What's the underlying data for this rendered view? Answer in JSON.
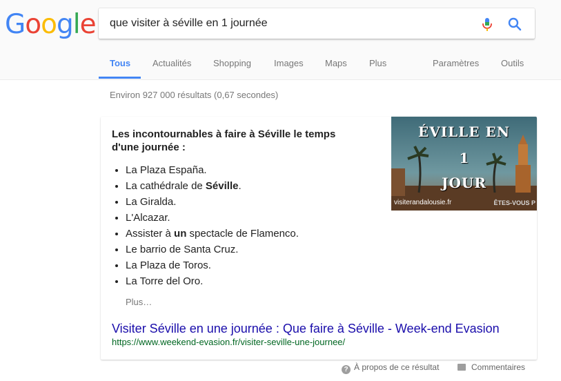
{
  "logo": {
    "letters": [
      {
        "ch": "G",
        "color": "#4285F4"
      },
      {
        "ch": "o",
        "color": "#EA4335"
      },
      {
        "ch": "o",
        "color": "#FBBC05"
      },
      {
        "ch": "g",
        "color": "#4285F4"
      },
      {
        "ch": "l",
        "color": "#34A853"
      },
      {
        "ch": "e",
        "color": "#EA4335"
      }
    ]
  },
  "search": {
    "query": "que visiter à séville en 1 journée",
    "mic_icon": "microphone-icon",
    "search_icon": "search-icon"
  },
  "tabs": {
    "all": "Tous",
    "news": "Actualités",
    "shopping": "Shopping",
    "images": "Images",
    "maps": "Maps",
    "more": "Plus",
    "settings": "Paramètres",
    "tools": "Outils"
  },
  "stats": "Environ 927 000 résultats (0,67 secondes)",
  "snippet": {
    "title": "Les incontournables à faire à Séville le temps d'une journée :",
    "items": [
      {
        "pre": "La Plaza España.",
        "bold": "",
        "post": ""
      },
      {
        "pre": "La cathédrale de ",
        "bold": "Séville",
        "post": "."
      },
      {
        "pre": "La Giralda.",
        "bold": "",
        "post": ""
      },
      {
        "pre": "L'Alcazar.",
        "bold": "",
        "post": ""
      },
      {
        "pre": "Assister à ",
        "bold": "un",
        "post": " spectacle de Flamenco."
      },
      {
        "pre": "Le barrio de Santa Cruz.",
        "bold": "",
        "post": ""
      },
      {
        "pre": "La Plaza de Toros.",
        "bold": "",
        "post": ""
      },
      {
        "pre": "La Torre del Oro.",
        "bold": "",
        "post": ""
      }
    ],
    "more": "Plus…",
    "image": {
      "line1": "ÉVILLE EN",
      "line2": "1",
      "line3": "JOUR",
      "tagline": "ÊTES-VOUS P",
      "site": "visiterandalousie.fr"
    },
    "result_title": "Visiter Séville en une journée : Que faire à Séville - Week-end Evasion",
    "result_url": "https://www.weekend-evasion.fr/visiter-seville-une-journee/"
  },
  "footer": {
    "about": "À propos de ce résultat",
    "feedback": "Commentaires"
  },
  "colors": {
    "link": "#1a0dab",
    "url": "#006621",
    "accent": "#4285f4"
  }
}
